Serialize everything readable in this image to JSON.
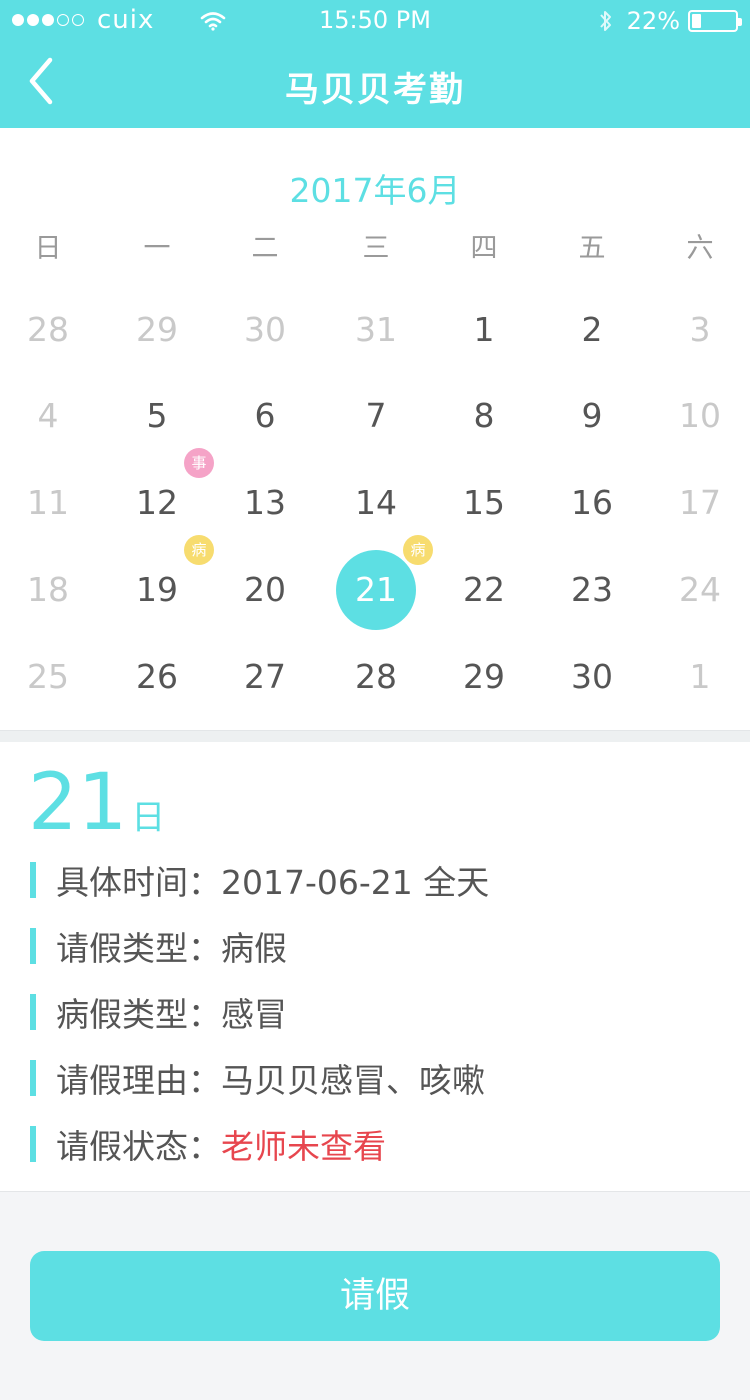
{
  "status_bar": {
    "carrier": "cuix",
    "time": "15:50 PM",
    "battery": "22%",
    "battery_level": 0.22,
    "signal_bars_filled": 3,
    "signal_bars_total": 5
  },
  "nav": {
    "title": "马贝贝考勤",
    "back_icon": "chevron-left-icon"
  },
  "calendar": {
    "month_title": "2017年6月",
    "weekdays": [
      "日",
      "一",
      "二",
      "三",
      "四",
      "五",
      "六"
    ],
    "weeks": [
      [
        {
          "d": "28",
          "muted": true
        },
        {
          "d": "29",
          "muted": true
        },
        {
          "d": "30",
          "muted": true
        },
        {
          "d": "31",
          "muted": true
        },
        {
          "d": "1"
        },
        {
          "d": "2"
        },
        {
          "d": "3",
          "muted": true
        }
      ],
      [
        {
          "d": "4",
          "muted": true
        },
        {
          "d": "5"
        },
        {
          "d": "6"
        },
        {
          "d": "7"
        },
        {
          "d": "8"
        },
        {
          "d": "9"
        },
        {
          "d": "10",
          "muted": true
        }
      ],
      [
        {
          "d": "11",
          "muted": true
        },
        {
          "d": "12",
          "tag": "事",
          "tag_color": "#f5a3c7"
        },
        {
          "d": "13"
        },
        {
          "d": "14"
        },
        {
          "d": "15"
        },
        {
          "d": "16"
        },
        {
          "d": "17",
          "muted": true
        }
      ],
      [
        {
          "d": "18",
          "muted": true
        },
        {
          "d": "19",
          "tag": "病",
          "tag_color": "#f7dc6f"
        },
        {
          "d": "20"
        },
        {
          "d": "21",
          "selected": true,
          "tag": "病",
          "tag_color": "#f7dc6f"
        },
        {
          "d": "22"
        },
        {
          "d": "23"
        },
        {
          "d": "24",
          "muted": true
        }
      ],
      [
        {
          "d": "25",
          "muted": true
        },
        {
          "d": "26"
        },
        {
          "d": "27"
        },
        {
          "d": "28"
        },
        {
          "d": "29"
        },
        {
          "d": "30"
        },
        {
          "d": "1",
          "muted": true
        }
      ]
    ]
  },
  "detail": {
    "day_number": "21",
    "day_unit": "日",
    "rows": [
      {
        "label": "具体时间：",
        "value": "2017-06-21 全天",
        "highlight": false
      },
      {
        "label": "请假类型：",
        "value": "病假",
        "highlight": false
      },
      {
        "label": "病假类型：",
        "value": "感冒",
        "highlight": false
      },
      {
        "label": "请假理由：",
        "value": "马贝贝感冒、咳嗽",
        "highlight": false
      },
      {
        "label": "请假状态：",
        "value": "老师未查看",
        "highlight": true
      }
    ]
  },
  "action": {
    "leave_button_label": "请假"
  },
  "colors": {
    "accent": "#5ddfe3",
    "alert": "#e7464e",
    "tag_personal": "#f5a3c7",
    "tag_sick": "#f7dc6f"
  }
}
